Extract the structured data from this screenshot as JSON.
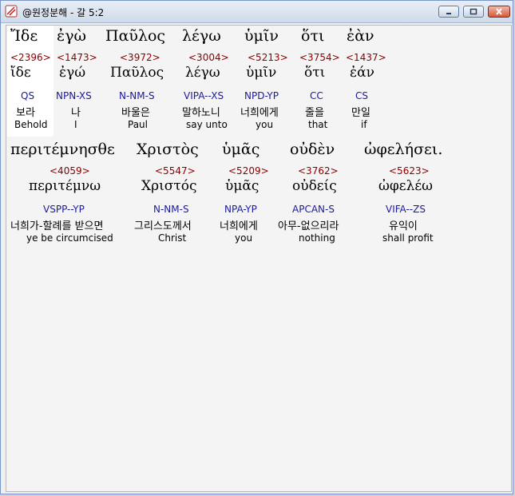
{
  "window": {
    "title": "@원정분해 - 갈 5:2"
  },
  "row1": [
    {
      "greek": "Ἴδε",
      "strong": "<2396>",
      "lemma": "ἴδε",
      "parse": "QS",
      "korean": "보라",
      "english": "Behold"
    },
    {
      "greek": "ἐγὼ",
      "strong": "<1473>",
      "lemma": "ἐγώ",
      "parse": "NPN-XS",
      "korean": "나",
      "english": "I"
    },
    {
      "greek": "Παῦλος",
      "strong": "<3972>",
      "lemma": "Παῦλος",
      "parse": "N-NM-S",
      "korean": "바울은",
      "english": "Paul"
    },
    {
      "greek": "λέγω",
      "strong": "<3004>",
      "lemma": "λέγω",
      "parse": "VIPA--XS",
      "korean": "말하노니",
      "english": "say unto"
    },
    {
      "greek": "ὑμῖν",
      "strong": "<5213>",
      "lemma": "ὑμῖν",
      "parse": "NPD-YP",
      "korean": "너희에게",
      "english": "you"
    },
    {
      "greek": "ὅτι",
      "strong": "<3754>",
      "lemma": "ὅτι",
      "parse": "CC",
      "korean": "줄을",
      "english": "that"
    },
    {
      "greek": "ἐὰν",
      "strong": "<1437>",
      "lemma": "ἐάν",
      "parse": "CS",
      "korean": "만일",
      "english": "if"
    }
  ],
  "row2": [
    {
      "greek": "περιτέμνησθε",
      "strong": "<4059>",
      "lemma": "περιτέμνω",
      "parse": "VSPP--YP",
      "korean": "너희가-할례를 받으면",
      "english": "ye be circumcised"
    },
    {
      "greek": "Χριστὸς",
      "strong": "<5547>",
      "lemma": "Χριστός",
      "parse": "N-NM-S",
      "korean": "그리스도께서",
      "english": "Christ"
    },
    {
      "greek": "ὑμᾶς",
      "strong": "<5209>",
      "lemma": "ὑμᾶς",
      "parse": "NPA-YP",
      "korean": "너희에게",
      "english": "you"
    },
    {
      "greek": "οὐδὲν",
      "strong": "<3762>",
      "lemma": "οὐδείς",
      "parse": "APCAN-S",
      "korean": "아무-없으리라",
      "english": "nothing"
    },
    {
      "greek": "ὠφελήσει.",
      "strong": "<5623>",
      "lemma": "ὠφελέω",
      "parse": "VIFA--ZS",
      "korean": "유익이",
      "english": "shall profit"
    }
  ]
}
